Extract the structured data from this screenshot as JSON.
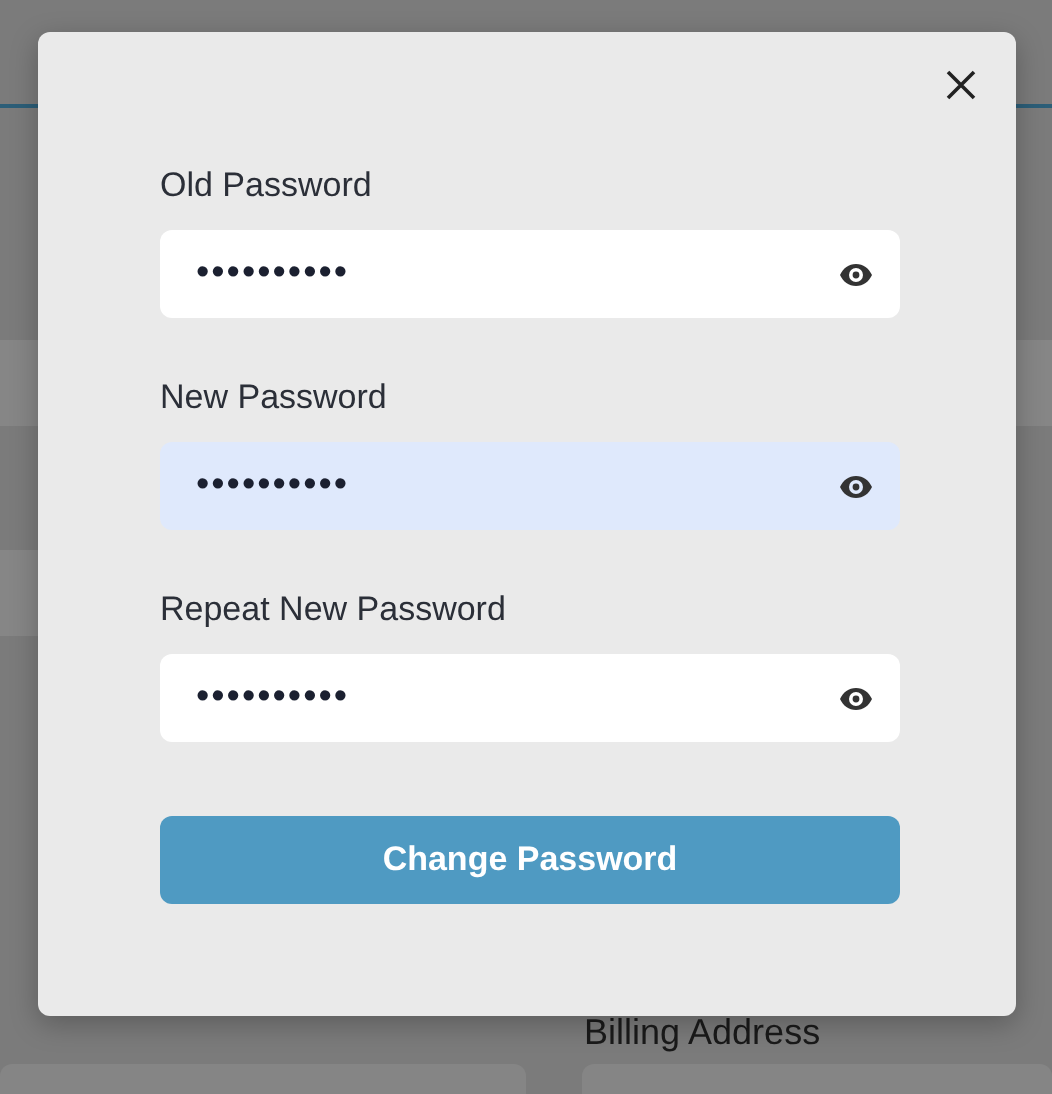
{
  "background": {
    "section_label": "Billing Address"
  },
  "dialog": {
    "fields": [
      {
        "label": "Old Password",
        "value": "••••••••••",
        "highlighted": false
      },
      {
        "label": "New Password",
        "value": "••••••••••",
        "highlighted": true
      },
      {
        "label": "Repeat New Password",
        "value": "••••••••••",
        "highlighted": false
      }
    ],
    "submit_button": "Change Password"
  }
}
